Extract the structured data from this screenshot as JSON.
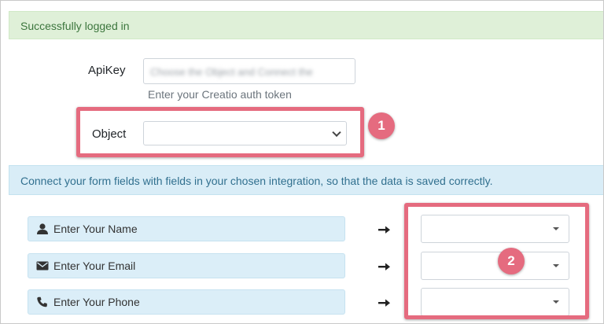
{
  "alerts": {
    "success": "Successfully logged in",
    "info": "Connect your form fields with fields in your chosen integration, so that the data is saved correctly."
  },
  "apikey": {
    "label": "ApiKey",
    "value": "Choose the Object and Connect the",
    "help": "Enter your Creatio auth token"
  },
  "object": {
    "label": "Object",
    "selected": ""
  },
  "annotations": {
    "badge1": "1",
    "badge2": "2",
    "highlight_color": "#e56b7f"
  },
  "mappings": [
    {
      "field": "Enter Your Name",
      "icon": "user-icon",
      "selected": ""
    },
    {
      "field": "Enter Your Email",
      "icon": "envelope-icon",
      "selected": ""
    },
    {
      "field": "Enter Your Phone",
      "icon": "phone-icon",
      "selected": ""
    }
  ],
  "colors": {
    "success_bg": "#dff0d8",
    "success_text": "#3c763d",
    "info_bg": "#d9edf7",
    "info_text": "#31708f",
    "chip_bg": "#dbeef8"
  }
}
